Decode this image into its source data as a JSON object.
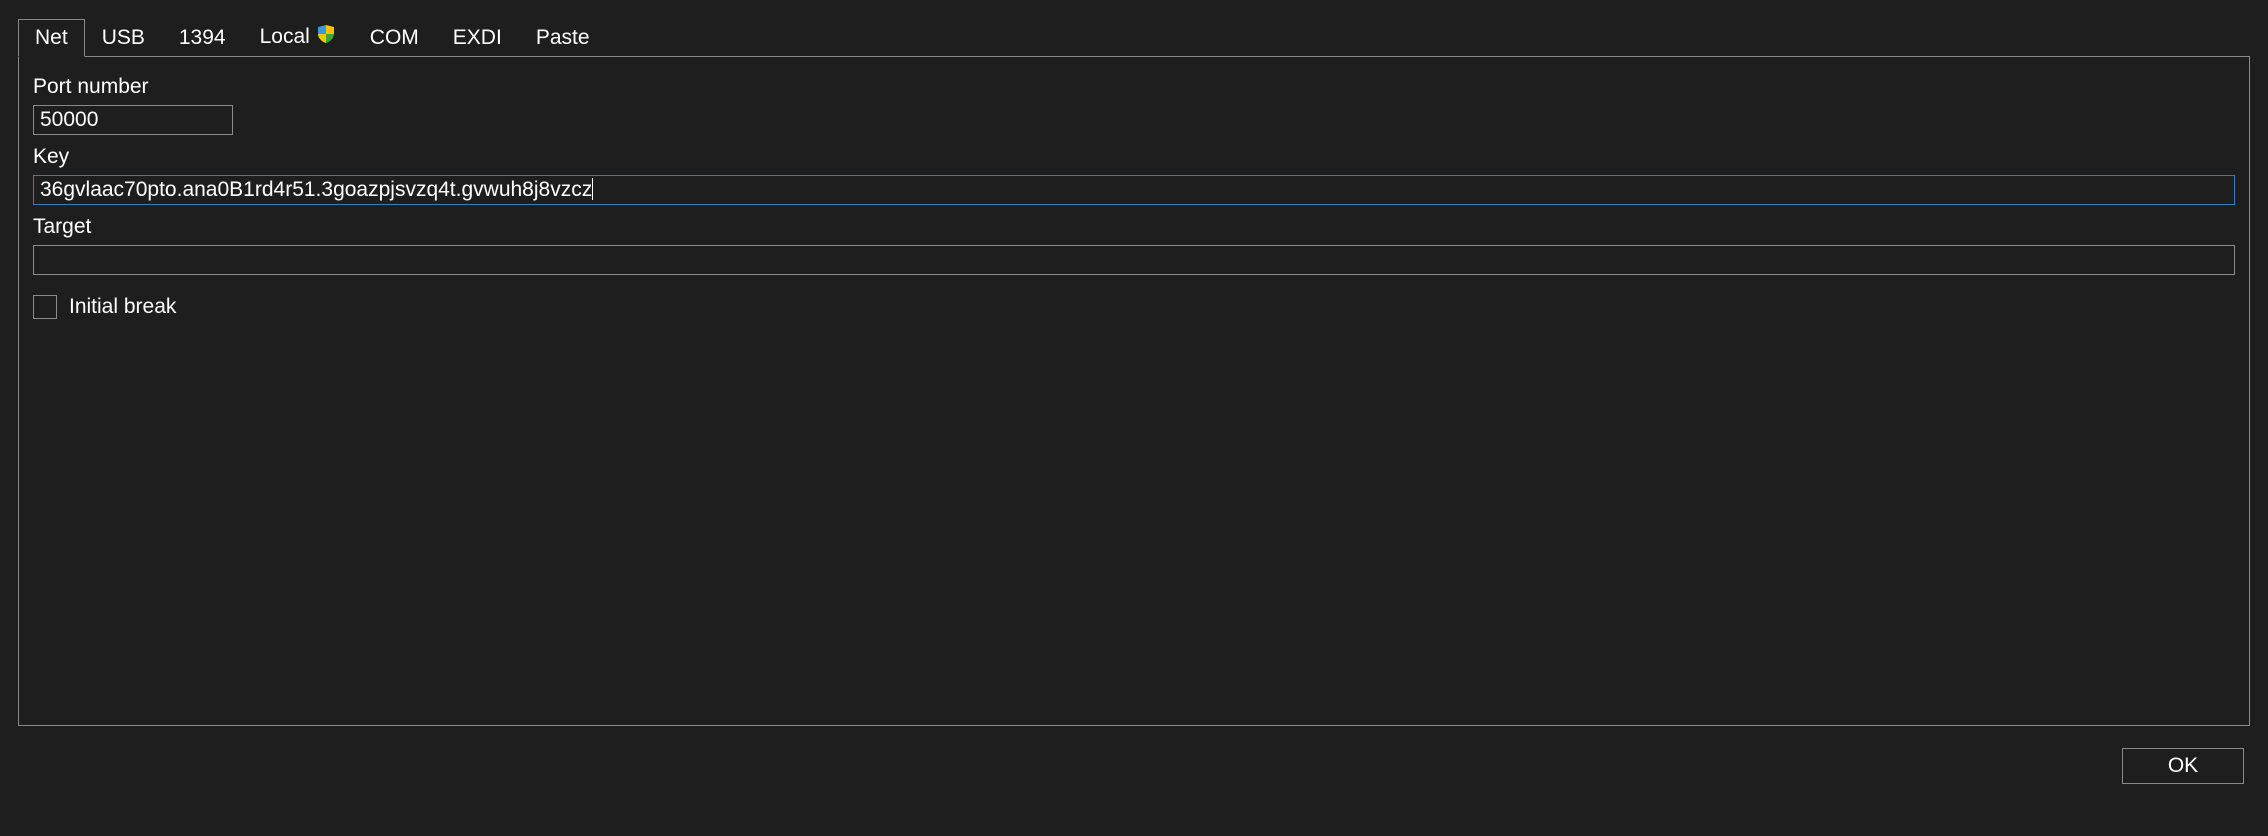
{
  "tabs": {
    "items": [
      {
        "label": "Net"
      },
      {
        "label": "USB"
      },
      {
        "label": "1394"
      },
      {
        "label": "Local"
      },
      {
        "label": "COM"
      },
      {
        "label": "EXDI"
      },
      {
        "label": "Paste"
      }
    ],
    "active_index": 0
  },
  "form": {
    "port_label": "Port number",
    "port_value": "50000",
    "key_label": "Key",
    "key_value": "36gvlaac70pto.ana0B1rd4r51.3goazpjsvzq4t.gvwuh8j8vzcz",
    "target_label": "Target",
    "target_value": "",
    "initial_break_label": "Initial break",
    "initial_break_checked": false
  },
  "footer": {
    "ok_label": "OK"
  }
}
